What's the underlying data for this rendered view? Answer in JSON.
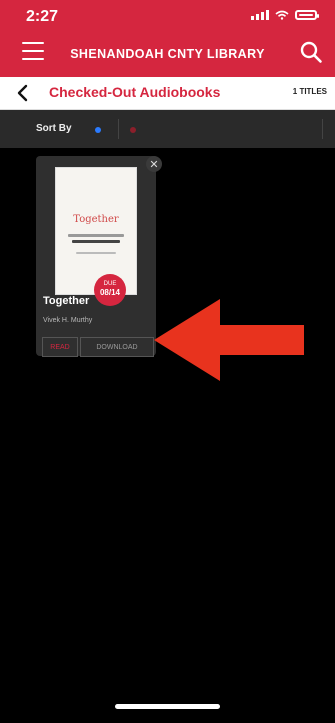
{
  "status_bar": {
    "time": "2:27"
  },
  "header": {
    "app_title": "SHENANDOAH CNTY LIBRARY",
    "menu_icon": "hamburger-menu-icon",
    "search_icon": "search-icon"
  },
  "subheader": {
    "title": "Checked-Out Audiobooks",
    "count": "1 TITLES",
    "back_icon": "chevron-left-icon"
  },
  "sort_bar": {
    "label": "Sort By"
  },
  "book": {
    "cover_title": "Together",
    "title": "Together",
    "author": "Vivek H. Murthy",
    "due_badge_label": "DUE",
    "due_date": "08/14",
    "read_label": "READ",
    "download_label": "DOWNLOAD"
  },
  "colors": {
    "brand_red": "#d5263f",
    "background": "#000000",
    "card": "#2f2f2f",
    "annotation_arrow": "#e8331e"
  }
}
